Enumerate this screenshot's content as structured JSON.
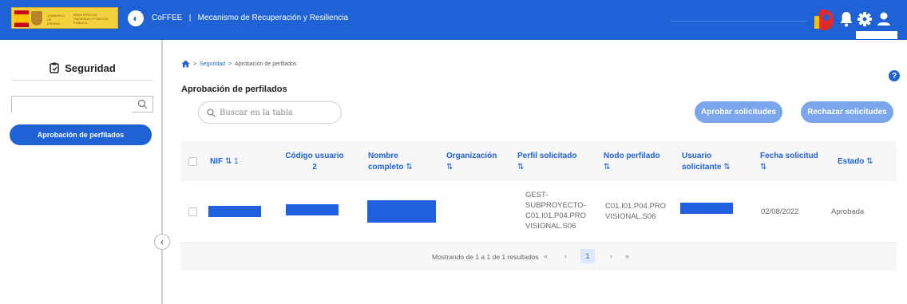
{
  "header": {
    "logo_line1": "GOBIERNO DE ESPAÑA",
    "logo_line2": "MINISTERIO DE HACIENDA Y FUNCIÓN PÚBLICA",
    "app_name": "CoFFEE",
    "separator": "|",
    "subtitle": "Mecanismo de Recuperación y Resiliencia",
    "icons": [
      "bell-icon",
      "gear-icon",
      "user-icon"
    ]
  },
  "sidebar": {
    "title": "Seguridad",
    "search_value": "",
    "items": [
      {
        "label": "Aprobación de perfilados",
        "active": true
      }
    ],
    "collapse_glyph": "‹"
  },
  "breadcrumb": {
    "items": [
      "Seguridad",
      "Aprobación de perfilados"
    ],
    "separator": ">"
  },
  "page": {
    "title": "Aprobación de perfilados",
    "help": "?",
    "search_placeholder": "Buscar en la tabla",
    "approve_label": "Aprobar solicitudes",
    "reject_label": "Rechazar solicitudes"
  },
  "table": {
    "columns": [
      {
        "l1": "NIF",
        "sort": "⇅ 1"
      },
      {
        "l1": "Código usuario",
        "l2": "2"
      },
      {
        "l1": "Nombre",
        "l2": "completo",
        "sort": "⇅"
      },
      {
        "l1": "Organización",
        "sort": "⇅"
      },
      {
        "l1": "Perfil solicitado",
        "sort": "⇅"
      },
      {
        "l1": "Nodo perfilado",
        "sort": "⇅"
      },
      {
        "l1": "Usuario",
        "l2": "solicitante",
        "sort": "⇅"
      },
      {
        "l1": "Fecha solicitud",
        "sort": "⇅"
      },
      {
        "l1": "Estado",
        "sort": "⇅"
      }
    ],
    "rows": [
      {
        "perfil_lines": [
          "GEST-",
          "SUBPROYECTO-",
          "C01.I01.P04.PRO",
          "VISIONAL.S06"
        ],
        "nodo_lines": [
          "C01.I01.P04.PRO",
          "VISIONAL.S06"
        ],
        "fecha": "02/08/2022",
        "estado": "Aprobada"
      }
    ]
  },
  "pagination": {
    "summary": "Mostrando de 1 a 1 de 1 resultados",
    "first": "«",
    "prev": "‹",
    "current": "1",
    "next": "›",
    "last": "»"
  },
  "colors": {
    "primary": "#1f62d6",
    "button_disabled": "#7aa6ec",
    "redaction": "#1f5fe0"
  }
}
